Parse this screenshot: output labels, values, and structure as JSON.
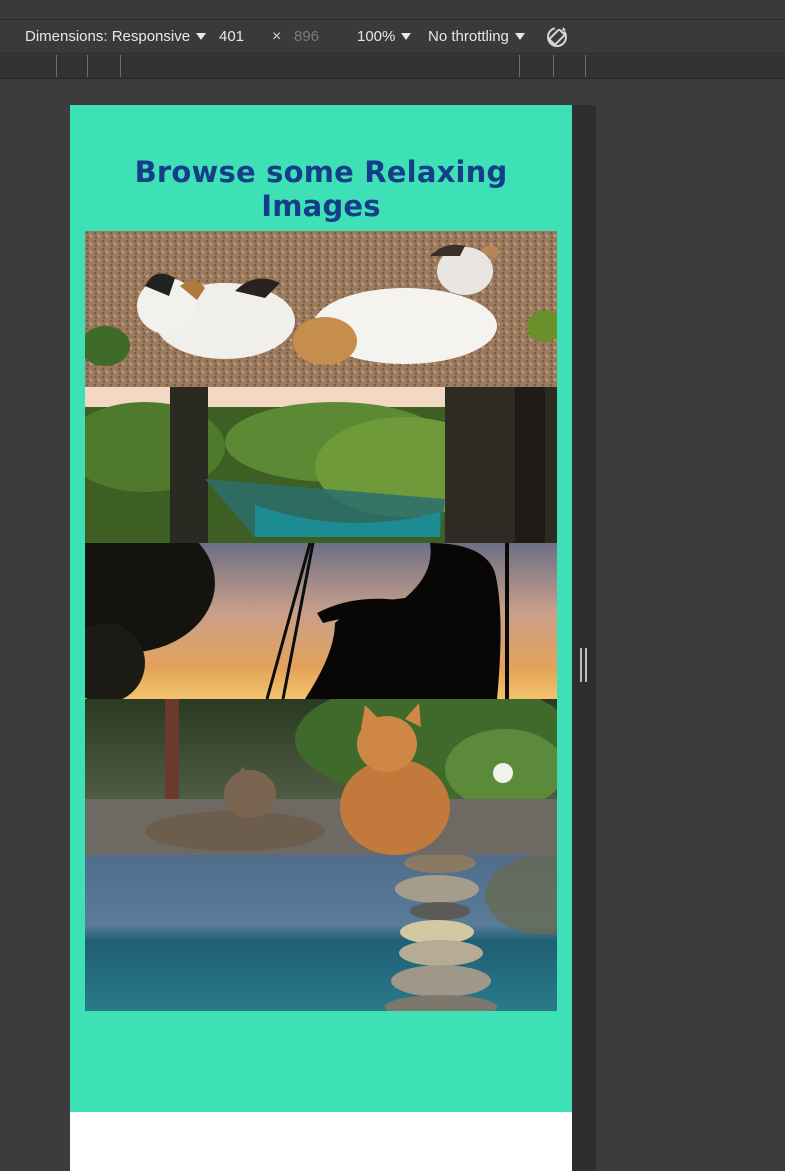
{
  "devtools": {
    "dimensions_label": "Dimensions: Responsive",
    "width": "401",
    "separator": "×",
    "height": "896",
    "zoom": "100%",
    "throttling": "No throttling",
    "icons": [
      "caret-down-icon",
      "rotate-icon",
      "resize-handle-icon"
    ]
  },
  "page": {
    "title": "Browse some Relaxing Images",
    "background": "#3ee0b6",
    "title_color": "#163d8a",
    "images": [
      {
        "subject": "two kittens lying on gravel"
      },
      {
        "subject": "person in a hammock among trees"
      },
      {
        "subject": "silhouette of woman sitting on a swing at sunset"
      },
      {
        "subject": "two cats on the ground"
      },
      {
        "subject": "stacked stones by the sea"
      }
    ]
  }
}
